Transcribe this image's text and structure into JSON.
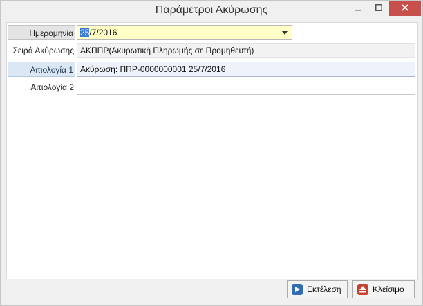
{
  "window": {
    "title": "Παράμετροι Ακύρωσης"
  },
  "form": {
    "date": {
      "label": "Ημερομηνία",
      "value_selected": "25",
      "value_rest": "/7/2016"
    },
    "series": {
      "label": "Σειρά Ακύρωσης",
      "value": "ΑΚΠΠΡ(Ακυρωτική Πληρωμής σε Προμηθευτή)"
    },
    "reason1": {
      "label": "Αιτιολογία 1",
      "value": "Ακύρωση: ΠΠΡ-0000000001 25/7/2016"
    },
    "reason2": {
      "label": "Αιτιολογία 2",
      "value": ""
    }
  },
  "buttons": {
    "execute": "Εκτέλεση",
    "close": "Κλείσιμο"
  },
  "icons": {
    "minimize": "minimize-icon",
    "maximize": "maximize-icon",
    "close": "close-icon",
    "dropdown": "chevron-down-icon",
    "execute": "play-icon",
    "close_dialog": "eject-icon"
  },
  "colors": {
    "close_button": "#c7504c",
    "date_field_bg": "#ffffc6",
    "selection": "#3a7bd5",
    "execute_icon": "#2f6eb5",
    "close_icon": "#c8412e"
  }
}
